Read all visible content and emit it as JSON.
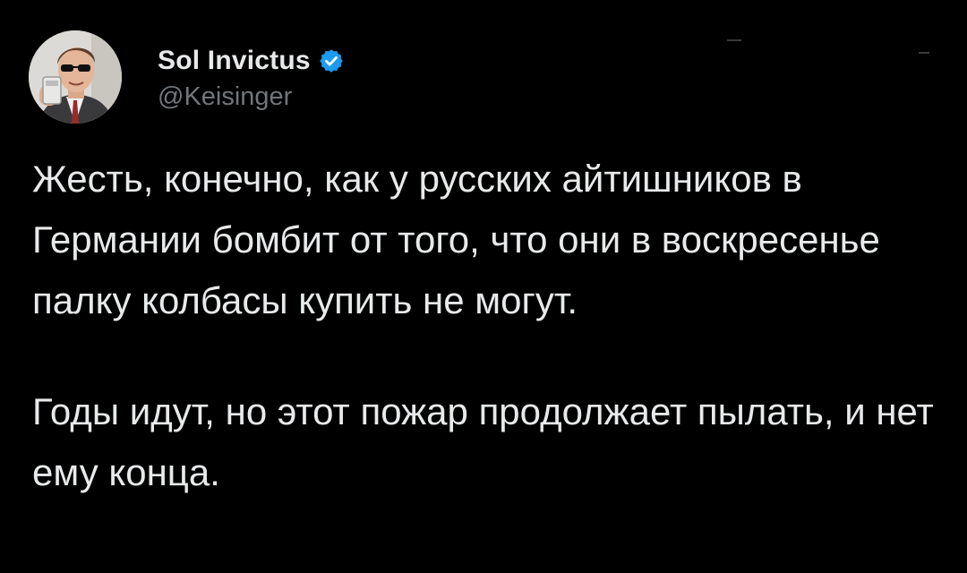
{
  "author": {
    "display_name": "Sol Invictus",
    "handle": "@Keisinger",
    "verified": true,
    "avatar_icon": "profile-photo-man-sunglasses-phone"
  },
  "tweet": {
    "paragraph_1": "Жесть, конечно, как у русских айтишников в Германии бомбит от того, что они в воскресенье палку колбасы купить не могут.",
    "paragraph_2": "Годы идут, но этот пожар продолжает пылать, и нет ему конца."
  },
  "colors": {
    "background": "#000000",
    "text_primary": "#e7e9ea",
    "text_secondary": "#71767b",
    "verified_badge": "#1d9bf0"
  }
}
